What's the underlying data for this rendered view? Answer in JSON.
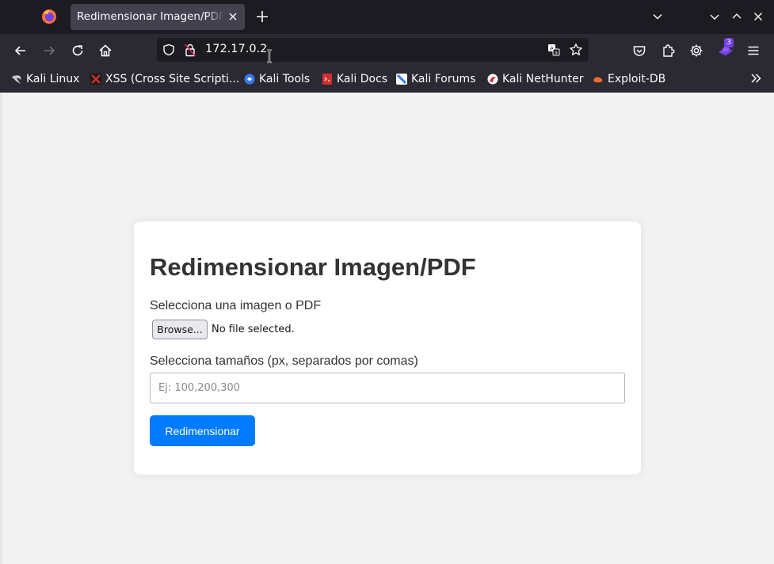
{
  "browser": {
    "tab": {
      "title": "Redimensionar Imagen/PDF"
    },
    "url": "172.17.0.2",
    "colors": {
      "chrome_dark": "#1c1b22",
      "chrome": "#2b2a33",
      "tab_active": "#42414d",
      "extension_badge": "#7542e5"
    },
    "extension_badge_count": "3",
    "bookmarks": [
      {
        "label": "Kali Linux",
        "icon": "kali-dragon-icon"
      },
      {
        "label": "XSS (Cross Site Scripti...",
        "icon": "xss-icon"
      },
      {
        "label": "Kali Tools",
        "icon": "kali-tools-icon"
      },
      {
        "label": "Kali Docs",
        "icon": "kali-docs-icon"
      },
      {
        "label": "Kali Forums",
        "icon": "kali-forums-icon"
      },
      {
        "label": "Kali NetHunter",
        "icon": "nethunter-icon"
      },
      {
        "label": "Exploit-DB",
        "icon": "exploit-db-icon"
      }
    ]
  },
  "page": {
    "heading": "Redimensionar Imagen/PDF",
    "file_label": "Selecciona una imagen o PDF",
    "browse_label": "Browse...",
    "file_status": "No file selected.",
    "sizes_label": "Selecciona tamaños (px, separados por comas)",
    "sizes_placeholder": "Ej: 100,200,300",
    "submit_label": "Redimensionar",
    "colors": {
      "accent": "#007bff",
      "text": "#333333",
      "background": "#f2f2f2",
      "card": "#ffffff"
    }
  }
}
